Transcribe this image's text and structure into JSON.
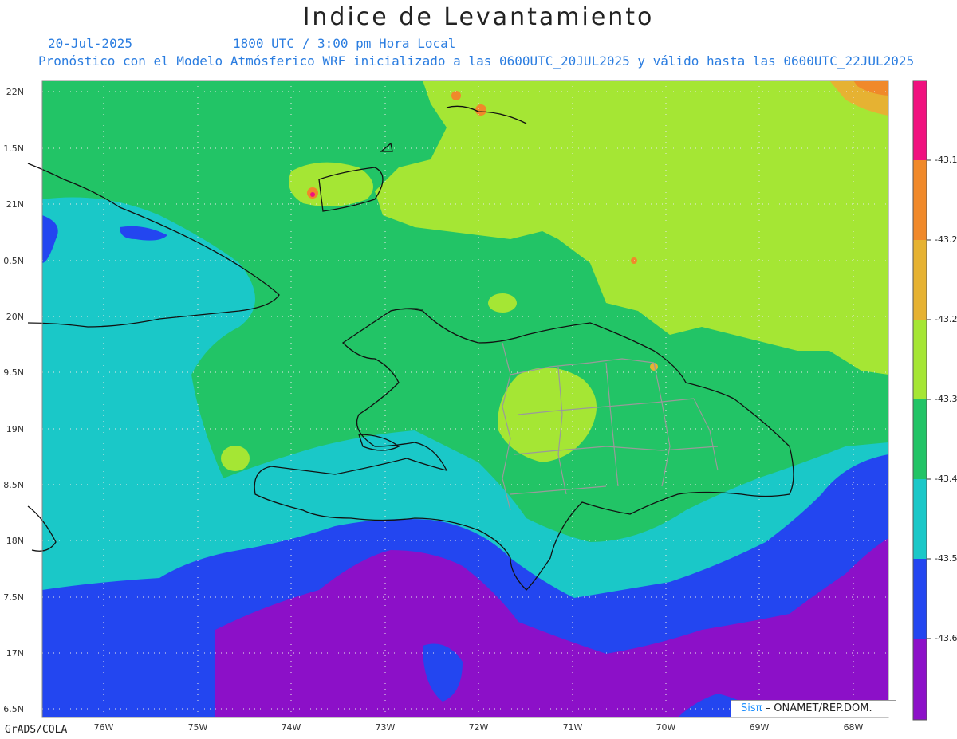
{
  "header": {
    "title": "Indice de Levantamiento",
    "date": "20-Jul-2025",
    "time": "1800 UTC / 3:00 pm Hora Local",
    "forecast": "Pronóstico con el Modelo Atmósferico WRF inicializado a las 0600UTC_20JUL2025 y válido hasta las  0600UTC_22JUL2025"
  },
  "axes": {
    "lat_labels": [
      "22N",
      "1.5N",
      "21N",
      "0.5N",
      "20N",
      "9.5N",
      "19N",
      "8.5N",
      "18N",
      "7.5N",
      "17N",
      "6.5N"
    ],
    "lon_labels": [
      "76W",
      "75W",
      "74W",
      "73W",
      "72W",
      "71W",
      "70W",
      "69W",
      "68W"
    ]
  },
  "colorbar": {
    "labels": [
      "-43.1",
      "-43.2",
      "-43.2",
      "-43.3",
      "-43.4",
      "-43.5",
      "-43.6"
    ],
    "colors": [
      "#f0117f",
      "#f0892a",
      "#e6b232",
      "#a5e634",
      "#22c466",
      "#1ac8c8",
      "#2346f0",
      "#8c10c8"
    ]
  },
  "palette": {
    "magenta": "#f0117f",
    "orange": "#f0892a",
    "gold": "#e6b232",
    "lime": "#a5e634",
    "green": "#22c466",
    "cyan": "#1ac8c8",
    "blue": "#2346f0",
    "purple": "#8c10c8"
  },
  "credits": {
    "sis": "Sisπ",
    "org": " – ONAMET/REP.DOM.",
    "software": "GrADS/COLA"
  }
}
